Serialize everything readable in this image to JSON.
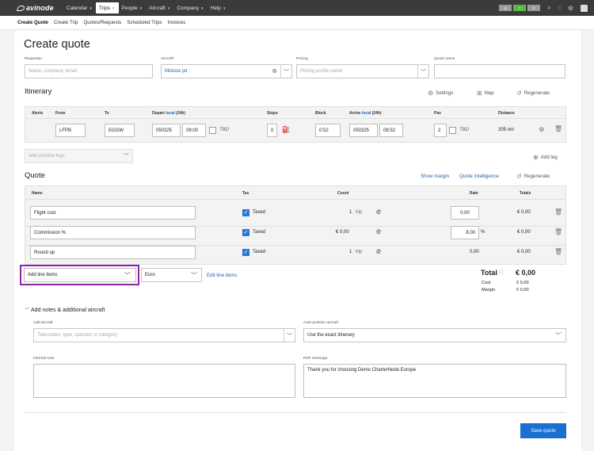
{
  "topbar": {
    "logo": "avinode",
    "nav": [
      {
        "label": "Calendar"
      },
      {
        "label": "Trips"
      },
      {
        "label": "People"
      },
      {
        "label": "Aircraft"
      },
      {
        "label": "Company"
      },
      {
        "label": "Help"
      }
    ],
    "pills": [
      {
        "label": "M",
        "color": "#9a9a9a"
      },
      {
        "label": "T",
        "color": "#5cb646"
      },
      {
        "label": "P",
        "color": "#9a9a9a"
      }
    ],
    "accent_color": "#3b3b3b"
  },
  "subnav": [
    "Create Quote",
    "Create Trip",
    "Quotes/Requests",
    "Scheduled Trips",
    "Invoices"
  ],
  "page_title": "Create quote",
  "requester": {
    "label": "Requester",
    "placeholder": "Name, company, email"
  },
  "aircraft": {
    "label": "Aircraft*",
    "value": "Midsize jet"
  },
  "pricing": {
    "label": "Pricing",
    "placeholder": "Pricing profile name"
  },
  "quote_name": {
    "label": "Quote name",
    "value": ""
  },
  "itinerary": {
    "title": "Itinerary",
    "settings": "Settings",
    "map": "Map",
    "regenerate": "Regenerate",
    "headers": {
      "alerts": "Alerts",
      "from": "From",
      "to": "To",
      "depart_prefix": "Depart",
      "depart_local": "local",
      "depart_suffix": "(24h)",
      "stops": "Stops",
      "block": "Block",
      "arrive_prefix": "Arrive",
      "arrive_local": "local",
      "arrive_suffix": "(24h)",
      "pax": "Pax",
      "distance": "Distance"
    },
    "leg": {
      "from": "LFPB",
      "to": "EGGW",
      "depart_date": "050325",
      "depart_time": "09:00",
      "tbd": "TBD",
      "stops": "0",
      "block": "0:52",
      "arrive_date": "050325",
      "arrive_time": "08:52",
      "pax": "2",
      "pax_tbd": "TBD",
      "distance": "205 nm"
    },
    "position_legs_placeholder": "Add position legs",
    "add_leg": "Add leg"
  },
  "quote": {
    "title": "Quote",
    "show_margin": "Show margin",
    "quote_intelligence": "Quote Intelligence",
    "regenerate": "Regenerate",
    "headers": {
      "name": "Name",
      "tax": "Tax",
      "count": "Count",
      "rate": "Rate",
      "totals": "Totals"
    },
    "lines": [
      {
        "name": "Flight cost",
        "tax": "Taxed",
        "count": "1",
        "count_unit": "trip",
        "at": "@",
        "rate": "0,00",
        "rate_suffix": "",
        "total": "€ 0,00"
      },
      {
        "name": "Commission %",
        "tax": "Taxed",
        "count": "€ 0,00",
        "count_unit": "",
        "at": "@",
        "rate": "8,00",
        "rate_suffix": "%",
        "total": "€ 0,00"
      },
      {
        "name": "Round up",
        "tax": "Taxed",
        "count": "1",
        "count_unit": "trip",
        "at": "@",
        "rate": "0,00",
        "rate_suffix": "",
        "total": "€ 0,00"
      }
    ],
    "add_line_items": "Add line items",
    "currency": "Euro",
    "edit_line_items": "Edit line items",
    "summary": {
      "total_label": "Total",
      "total_value": "€ 0,00",
      "cost_label": "Cost",
      "cost_value": "€ 0,00",
      "margin_label": "Margin",
      "margin_value": "€ 0,00"
    }
  },
  "notes": {
    "toggle": "Add notes & additional aircraft",
    "add_aircraft_label": "Add aircraft",
    "add_aircraft_placeholder": "Tailnumber, type, operator or category",
    "auto_position_label": "Auto-position aircraft",
    "auto_position_value": "Use the exact itinerary",
    "internal_note_label": "Internal note",
    "internal_note_value": "",
    "pdf_message_label": "PDF message",
    "pdf_message_value": "Thank you for choosing Demo CharterNode Europe"
  },
  "save_button": "Save quote",
  "colors": {
    "primary": "#1a6fd1",
    "link": "#1f64b5",
    "highlight": "#8e24aa",
    "checkbox": "#2a78d1"
  }
}
